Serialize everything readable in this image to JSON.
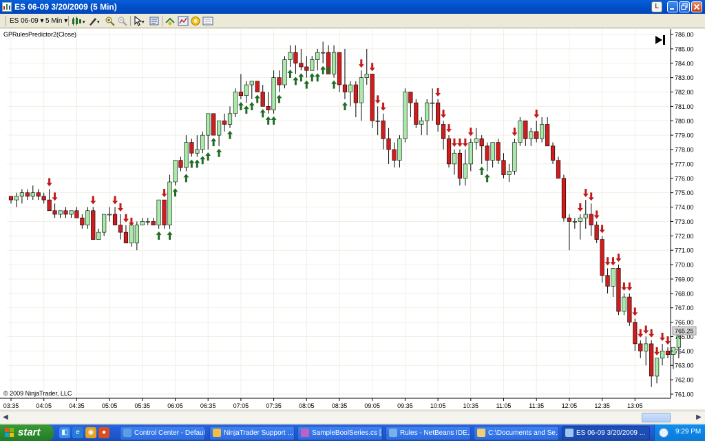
{
  "window": {
    "title": "ES 06-09  3/20/2009 (5 Min)",
    "btn_l": "L"
  },
  "toolbar": {
    "instrument": "ES 06-09",
    "interval": "5 Min",
    "icons": [
      "bar-type-icon",
      "drawing-tool-icon",
      "zoom-in-icon",
      "zoom-out-icon",
      "pointer-icon",
      "data-box-icon",
      "strategy-icon",
      "indicators-icon",
      "alert-icon",
      "properties-icon"
    ]
  },
  "chart": {
    "indicator_label": "GPRulesPredictor2(Close)",
    "copyright": "© 2009 NinjaTrader, LLC",
    "last_price_label": "765.25",
    "colors": {
      "up": "#a8eaa8",
      "down": "#d01c1c",
      "long_arrow": "#1e6b23",
      "short_arrow": "#c01a1a",
      "grid": "#efefe6"
    }
  },
  "chart_data": {
    "type": "candlestick",
    "ylim": [
      760.5,
      786.25
    ],
    "yticks": [
      "786.00",
      "785.00",
      "784.00",
      "783.00",
      "782.00",
      "781.00",
      "780.00",
      "779.00",
      "778.00",
      "777.00",
      "776.00",
      "775.00",
      "774.00",
      "773.00",
      "772.00",
      "771.00",
      "770.00",
      "769.00",
      "768.00",
      "767.00",
      "766.00",
      "765.00",
      "764.00",
      "763.00",
      "762.00",
      "761.00"
    ],
    "xticks": [
      {
        "i": 0,
        "label": "03:35"
      },
      {
        "i": 6,
        "label": "04:05"
      },
      {
        "i": 12,
        "label": "04:35"
      },
      {
        "i": 18,
        "label": "05:05"
      },
      {
        "i": 24,
        "label": "05:35"
      },
      {
        "i": 30,
        "label": "06:05"
      },
      {
        "i": 36,
        "label": "06:35"
      },
      {
        "i": 42,
        "label": "07:05"
      },
      {
        "i": 48,
        "label": "07:35"
      },
      {
        "i": 54,
        "label": "08:05"
      },
      {
        "i": 60,
        "label": "08:35"
      },
      {
        "i": 66,
        "label": "09:05"
      },
      {
        "i": 72,
        "label": "09:35"
      },
      {
        "i": 78,
        "label": "10:05"
      },
      {
        "i": 84,
        "label": "10:35"
      },
      {
        "i": 90,
        "label": "11:05"
      },
      {
        "i": 96,
        "label": "11:35"
      },
      {
        "i": 102,
        "label": "12:05"
      },
      {
        "i": 108,
        "label": "12:35"
      },
      {
        "i": 114,
        "label": "13:05"
      }
    ],
    "ohlc": [
      [
        774.75,
        774.75,
        774.25,
        774.5
      ],
      [
        774.5,
        775.0,
        774.0,
        774.75
      ],
      [
        774.75,
        775.25,
        774.25,
        775.0
      ],
      [
        775.0,
        775.25,
        774.5,
        774.75
      ],
      [
        774.75,
        775.5,
        774.5,
        775.0
      ],
      [
        775.0,
        775.25,
        774.5,
        774.75
      ],
      [
        774.75,
        775.0,
        774.25,
        774.5
      ],
      [
        774.5,
        775.25,
        774.25,
        773.75
      ],
      [
        773.75,
        774.25,
        773.25,
        773.5
      ],
      [
        773.5,
        773.75,
        773.25,
        773.75
      ],
      [
        773.75,
        774.0,
        773.25,
        773.5
      ],
      [
        773.5,
        773.75,
        773.25,
        773.75
      ],
      [
        773.75,
        774.0,
        773.25,
        773.25
      ],
      [
        773.25,
        773.5,
        772.5,
        772.75
      ],
      [
        772.75,
        774.0,
        772.5,
        773.75
      ],
      [
        773.75,
        774.0,
        771.75,
        771.75
      ],
      [
        771.75,
        772.5,
        771.75,
        772.25
      ],
      [
        772.25,
        773.5,
        772.0,
        773.5
      ],
      [
        773.5,
        774.0,
        773.0,
        773.5
      ],
      [
        773.5,
        774.0,
        773.25,
        772.75
      ],
      [
        772.75,
        773.5,
        771.75,
        772.25
      ],
      [
        772.25,
        772.75,
        771.75,
        771.5
      ],
      [
        771.5,
        772.5,
        771.25,
        772.75
      ],
      [
        771.5,
        773.0,
        771.0,
        772.75
      ],
      [
        772.75,
        773.25,
        772.75,
        773.0
      ],
      [
        773.0,
        773.25,
        772.75,
        773.0
      ],
      [
        773.0,
        773.25,
        772.75,
        772.75
      ],
      [
        772.75,
        774.5,
        772.5,
        774.5
      ],
      [
        774.5,
        774.5,
        772.5,
        772.75
      ],
      [
        772.75,
        776.25,
        772.5,
        775.75
      ],
      [
        775.75,
        777.25,
        775.5,
        777.25
      ],
      [
        777.25,
        777.5,
        776.5,
        776.75
      ],
      [
        776.75,
        779.0,
        776.5,
        778.5
      ],
      [
        778.5,
        778.75,
        777.5,
        777.75
      ],
      [
        777.75,
        779.0,
        777.5,
        778.0
      ],
      [
        778.0,
        779.25,
        777.75,
        779.0
      ],
      [
        779.0,
        780.5,
        778.0,
        780.5
      ],
      [
        780.5,
        780.5,
        779.0,
        779.0
      ],
      [
        779.0,
        780.0,
        778.25,
        780.0
      ],
      [
        780.0,
        780.5,
        779.25,
        779.75
      ],
      [
        779.75,
        781.0,
        779.5,
        780.5
      ],
      [
        780.5,
        782.25,
        780.25,
        782.0
      ],
      [
        782.0,
        783.25,
        781.5,
        781.75
      ],
      [
        781.75,
        782.75,
        781.25,
        782.5
      ],
      [
        782.5,
        782.75,
        781.5,
        782.75
      ],
      [
        782.75,
        782.75,
        782.0,
        782.0
      ],
      [
        782.0,
        782.5,
        781.0,
        781.0
      ],
      [
        781.0,
        782.0,
        780.5,
        780.75
      ],
      [
        780.75,
        783.5,
        780.5,
        783.0
      ],
      [
        783.0,
        783.5,
        782.0,
        782.5
      ],
      [
        782.5,
        784.5,
        782.25,
        784.25
      ],
      [
        784.25,
        785.25,
        783.75,
        784.75
      ],
      [
        784.75,
        785.25,
        783.25,
        784.0
      ],
      [
        784.0,
        785.0,
        783.5,
        783.75
      ],
      [
        783.75,
        784.5,
        783.0,
        783.5
      ],
      [
        783.5,
        784.5,
        783.5,
        784.25
      ],
      [
        784.25,
        785.0,
        783.5,
        784.75
      ],
      [
        784.75,
        785.5,
        784.0,
        784.75
      ],
      [
        784.75,
        785.25,
        784.0,
        783.25
      ],
      [
        783.25,
        785.25,
        783.0,
        784.75
      ],
      [
        784.75,
        784.75,
        782.0,
        782.5
      ],
      [
        782.5,
        785.0,
        781.5,
        782.0
      ],
      [
        782.0,
        782.75,
        781.0,
        782.5
      ],
      [
        782.5,
        782.75,
        780.25,
        781.25
      ],
      [
        781.25,
        783.5,
        780.0,
        783.0
      ],
      [
        783.0,
        785.0,
        782.5,
        783.25
      ],
      [
        783.25,
        783.25,
        779.5,
        780.0
      ],
      [
        780.0,
        781.0,
        779.0,
        780.0
      ],
      [
        780.0,
        780.5,
        778.0,
        778.75
      ],
      [
        778.75,
        779.5,
        777.0,
        778.0
      ],
      [
        778.0,
        778.5,
        776.75,
        777.25
      ],
      [
        777.25,
        779.0,
        776.75,
        778.75
      ],
      [
        778.75,
        782.25,
        778.5,
        782.0
      ],
      [
        782.0,
        782.0,
        780.25,
        781.25
      ],
      [
        781.25,
        781.5,
        779.5,
        779.75
      ],
      [
        779.75,
        780.25,
        779.0,
        780.0
      ],
      [
        780.0,
        781.5,
        779.0,
        781.25
      ],
      [
        781.25,
        782.25,
        780.0,
        781.25
      ],
      [
        781.25,
        781.5,
        779.25,
        779.75
      ],
      [
        779.75,
        780.0,
        778.0,
        778.75
      ],
      [
        778.75,
        779.0,
        776.75,
        777.0
      ],
      [
        777.0,
        778.0,
        776.25,
        777.75
      ],
      [
        777.75,
        778.0,
        775.5,
        776.0
      ],
      [
        776.0,
        778.0,
        775.5,
        777.0
      ],
      [
        777.0,
        778.75,
        776.5,
        778.5
      ],
      [
        778.5,
        779.5,
        778.0,
        778.75
      ],
      [
        778.75,
        779.0,
        777.0,
        778.25
      ],
      [
        778.25,
        778.5,
        776.5,
        777.25
      ],
      [
        777.25,
        778.5,
        776.75,
        778.5
      ],
      [
        778.5,
        778.75,
        777.0,
        777.25
      ],
      [
        777.25,
        777.75,
        776.0,
        776.25
      ],
      [
        776.25,
        777.0,
        775.75,
        776.5
      ],
      [
        776.5,
        778.75,
        776.25,
        778.5
      ],
      [
        778.5,
        780.25,
        778.25,
        780.0
      ],
      [
        780.0,
        780.0,
        778.25,
        778.75
      ],
      [
        778.75,
        779.5,
        778.25,
        779.25
      ],
      [
        779.25,
        780.0,
        778.5,
        778.75
      ],
      [
        778.75,
        780.25,
        778.5,
        779.75
      ],
      [
        779.75,
        780.25,
        778.5,
        778.25
      ],
      [
        778.25,
        778.5,
        777.0,
        777.25
      ],
      [
        777.25,
        777.5,
        776.0,
        776.0
      ],
      [
        776.0,
        776.25,
        773.0,
        773.25
      ],
      [
        773.25,
        773.5,
        771.0,
        773.0
      ],
      [
        773.0,
        773.25,
        772.5,
        773.0
      ],
      [
        773.0,
        773.5,
        771.75,
        773.25
      ],
      [
        773.25,
        774.5,
        772.5,
        773.5
      ],
      [
        773.5,
        774.25,
        772.0,
        772.75
      ],
      [
        772.75,
        773.0,
        771.5,
        771.75
      ],
      [
        771.75,
        772.0,
        768.75,
        769.25
      ],
      [
        769.25,
        769.75,
        768.0,
        768.5
      ],
      [
        768.5,
        769.75,
        767.75,
        769.75
      ],
      [
        769.75,
        770.0,
        766.5,
        766.75
      ],
      [
        766.75,
        768.0,
        766.5,
        767.75
      ],
      [
        767.75,
        768.0,
        765.75,
        766.0
      ],
      [
        766.0,
        766.25,
        764.0,
        764.5
      ],
      [
        764.5,
        764.75,
        763.5,
        764.0
      ],
      [
        764.0,
        765.0,
        763.0,
        764.5
      ],
      [
        764.5,
        764.75,
        761.5,
        762.25
      ],
      [
        762.25,
        763.5,
        761.75,
        763.5
      ],
      [
        763.5,
        764.5,
        763.0,
        764.0
      ],
      [
        764.0,
        764.25,
        763.5,
        763.75
      ],
      [
        763.75,
        764.0,
        762.75,
        764.25
      ],
      [
        764.25,
        765.75,
        763.5,
        765.25
      ]
    ],
    "long_signals": [
      27,
      29,
      30,
      32,
      33,
      34,
      35,
      36,
      37,
      38,
      40,
      42,
      43,
      44,
      45,
      46,
      47,
      48,
      49,
      51,
      52,
      53,
      54,
      55,
      56,
      57,
      58,
      59,
      61,
      86,
      87
    ],
    "short_signals": [
      7,
      8,
      15,
      19,
      20,
      21,
      22,
      28,
      64,
      66,
      67,
      68,
      78,
      79,
      80,
      81,
      82,
      83,
      84,
      92,
      96,
      104,
      105,
      106,
      107,
      108,
      109,
      110,
      111,
      112,
      113,
      114,
      115,
      116,
      117,
      118,
      119,
      120
    ]
  },
  "taskbar": {
    "start_label": "start",
    "tasks": [
      {
        "label": "Control Center - Default",
        "active": false,
        "color": "#5aa0e0"
      },
      {
        "label": "NinjaTrader Support ...",
        "active": false,
        "color": "#f0c040"
      },
      {
        "label": "SampleBoolSeries.cs [...",
        "active": false,
        "color": "#c060c0"
      },
      {
        "label": "Rules - NetBeans IDE...",
        "active": false,
        "color": "#7ab0e8"
      },
      {
        "label": "C:\\Documents and Se...",
        "active": false,
        "color": "#f2d070"
      },
      {
        "label": "ES 06-09  3/20/2009 ...",
        "active": true,
        "color": "#9cc8f0"
      }
    ],
    "clock": "9:29 PM"
  }
}
